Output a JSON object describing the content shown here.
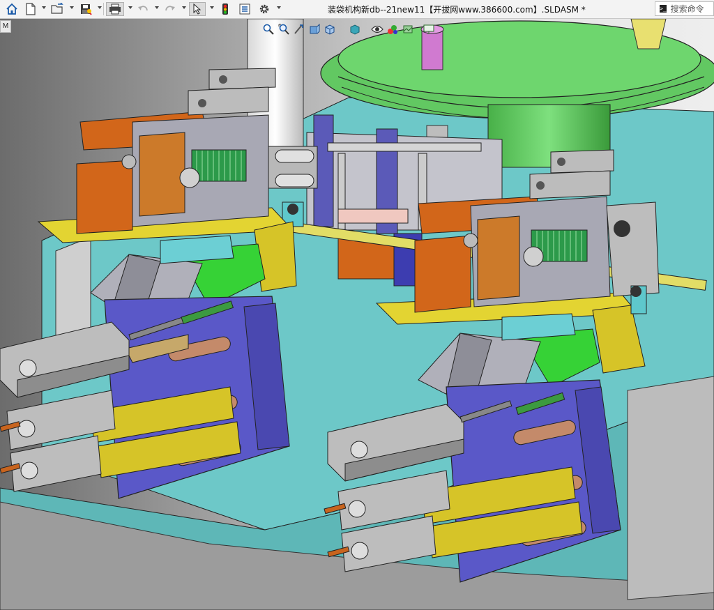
{
  "window": {
    "document_title": "装袋机构新db--21new11【开拔网www.386600.com】.SLDASM *"
  },
  "toolbar": {
    "icons": [
      "home-icon",
      "new-file-icon",
      "open-file-icon",
      "save-icon",
      "print-icon",
      "undo-icon",
      "redo-icon",
      "select-arrow-icon",
      "rebuild-traffic-light-icon",
      "file-properties-icon",
      "options-gear-icon"
    ]
  },
  "search": {
    "placeholder": "搜索命令"
  },
  "left_panel_tab": {
    "label": "M"
  },
  "heads_up_toolbar": {
    "icons": [
      "zoom-to-fit-icon",
      "zoom-to-area-icon",
      "previous-view-icon",
      "section-view-icon",
      "view-orientation-icon",
      "display-style-icon",
      "hide-show-items-icon",
      "edit-appearance-icon",
      "apply-scene-icon",
      "view-settings-icon"
    ]
  },
  "colors": {
    "titlebar": "#f3f3f3",
    "green_part": "#5ec85e",
    "purple_part": "#5a58c8",
    "yellow_part": "#d6c828",
    "orange_part": "#d2661a",
    "teal_floor": "#5fc3c3",
    "steel_part": "#9a9a9a"
  }
}
